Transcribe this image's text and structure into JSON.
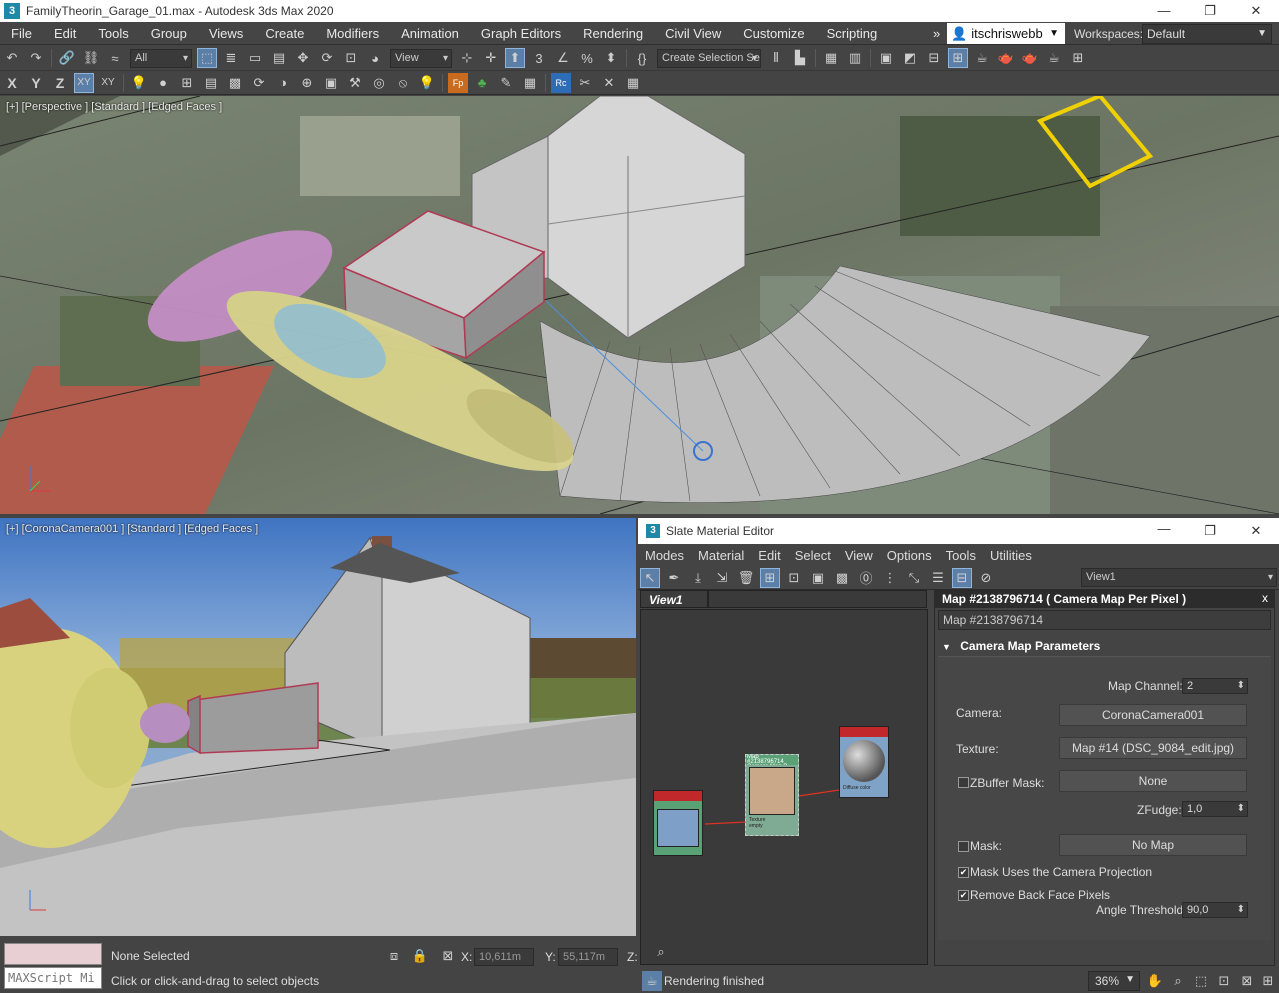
{
  "window": {
    "title": "FamilyTheorin_Garage_01.max - Autodesk 3ds Max 2020",
    "app_icon": "3",
    "minimize": "—",
    "maximize": "❐",
    "close": "✕"
  },
  "menu": {
    "items": [
      "File",
      "Edit",
      "Tools",
      "Group",
      "Views",
      "Create",
      "Modifiers",
      "Animation",
      "Graph Editors",
      "Rendering",
      "Civil View",
      "Customize",
      "Scripting"
    ],
    "overflow": "»",
    "user": "itschriswebb",
    "workspaces_label": "Workspaces:",
    "workspace": "Default"
  },
  "toolbar1": {
    "filter_select": "All",
    "ref_coord_select": "View",
    "named_selection": "Create Selection Se"
  },
  "toolbar2": {
    "axis_x": "X",
    "axis_y": "Y",
    "axis_z": "Z",
    "axis_xy": "XY",
    "axis_xy2": "XY"
  },
  "viewport_top": {
    "label": "[+] [Perspective ] [Standard ] [Edged Faces ]"
  },
  "viewport_bottom": {
    "label": "[+] [CoronaCamera001 ] [Standard ] [Edged Faces ]"
  },
  "status": {
    "maxscript": "MAXScript Mi",
    "selection": "None Selected",
    "prompt": "Click or click-and-drag to select objects",
    "x_label": "X:",
    "x_value": "10,611m",
    "y_label": "Y:",
    "y_value": "55,117m",
    "z_label": "Z:"
  },
  "slate": {
    "title": "Slate Material Editor",
    "menu": [
      "Modes",
      "Material",
      "Edit",
      "Select",
      "View",
      "Options",
      "Tools",
      "Utilities"
    ],
    "view_select": "View1",
    "view_tab": "View1",
    "rendering_status": "Rendering finished",
    "zoom": "36%",
    "nodes": {
      "camera_map_title": "Map #2138796714 Camera Map P...",
      "texture_slot": "Texture",
      "empty_slot": "empty",
      "diffuse_slot": "Diffuse color"
    }
  },
  "props": {
    "header": "Map #2138796714  ( Camera Map Per Pixel )",
    "close": "x",
    "name": "Map #2138796714",
    "rollout_title": "Camera Map Parameters",
    "map_channel_label": "Map Channel:",
    "map_channel": "2",
    "camera_label": "Camera:",
    "camera": "CoronaCamera001",
    "texture_label": "Texture:",
    "texture": "Map #14 (DSC_9084_edit.jpg)",
    "zbuffer_label": "ZBuffer Mask:",
    "zbuffer": "None",
    "zfudge_label": "ZFudge:",
    "zfudge": "1,0",
    "mask_label": "Mask:",
    "mask": "No Map",
    "mask_uses_camera": "Mask Uses the Camera Projection",
    "mask_uses_camera_checked": true,
    "remove_back_face": "Remove Back Face Pixels",
    "remove_back_face_checked": true,
    "angle_threshold_label": "Angle Threshold:",
    "angle_threshold": "90,0"
  }
}
